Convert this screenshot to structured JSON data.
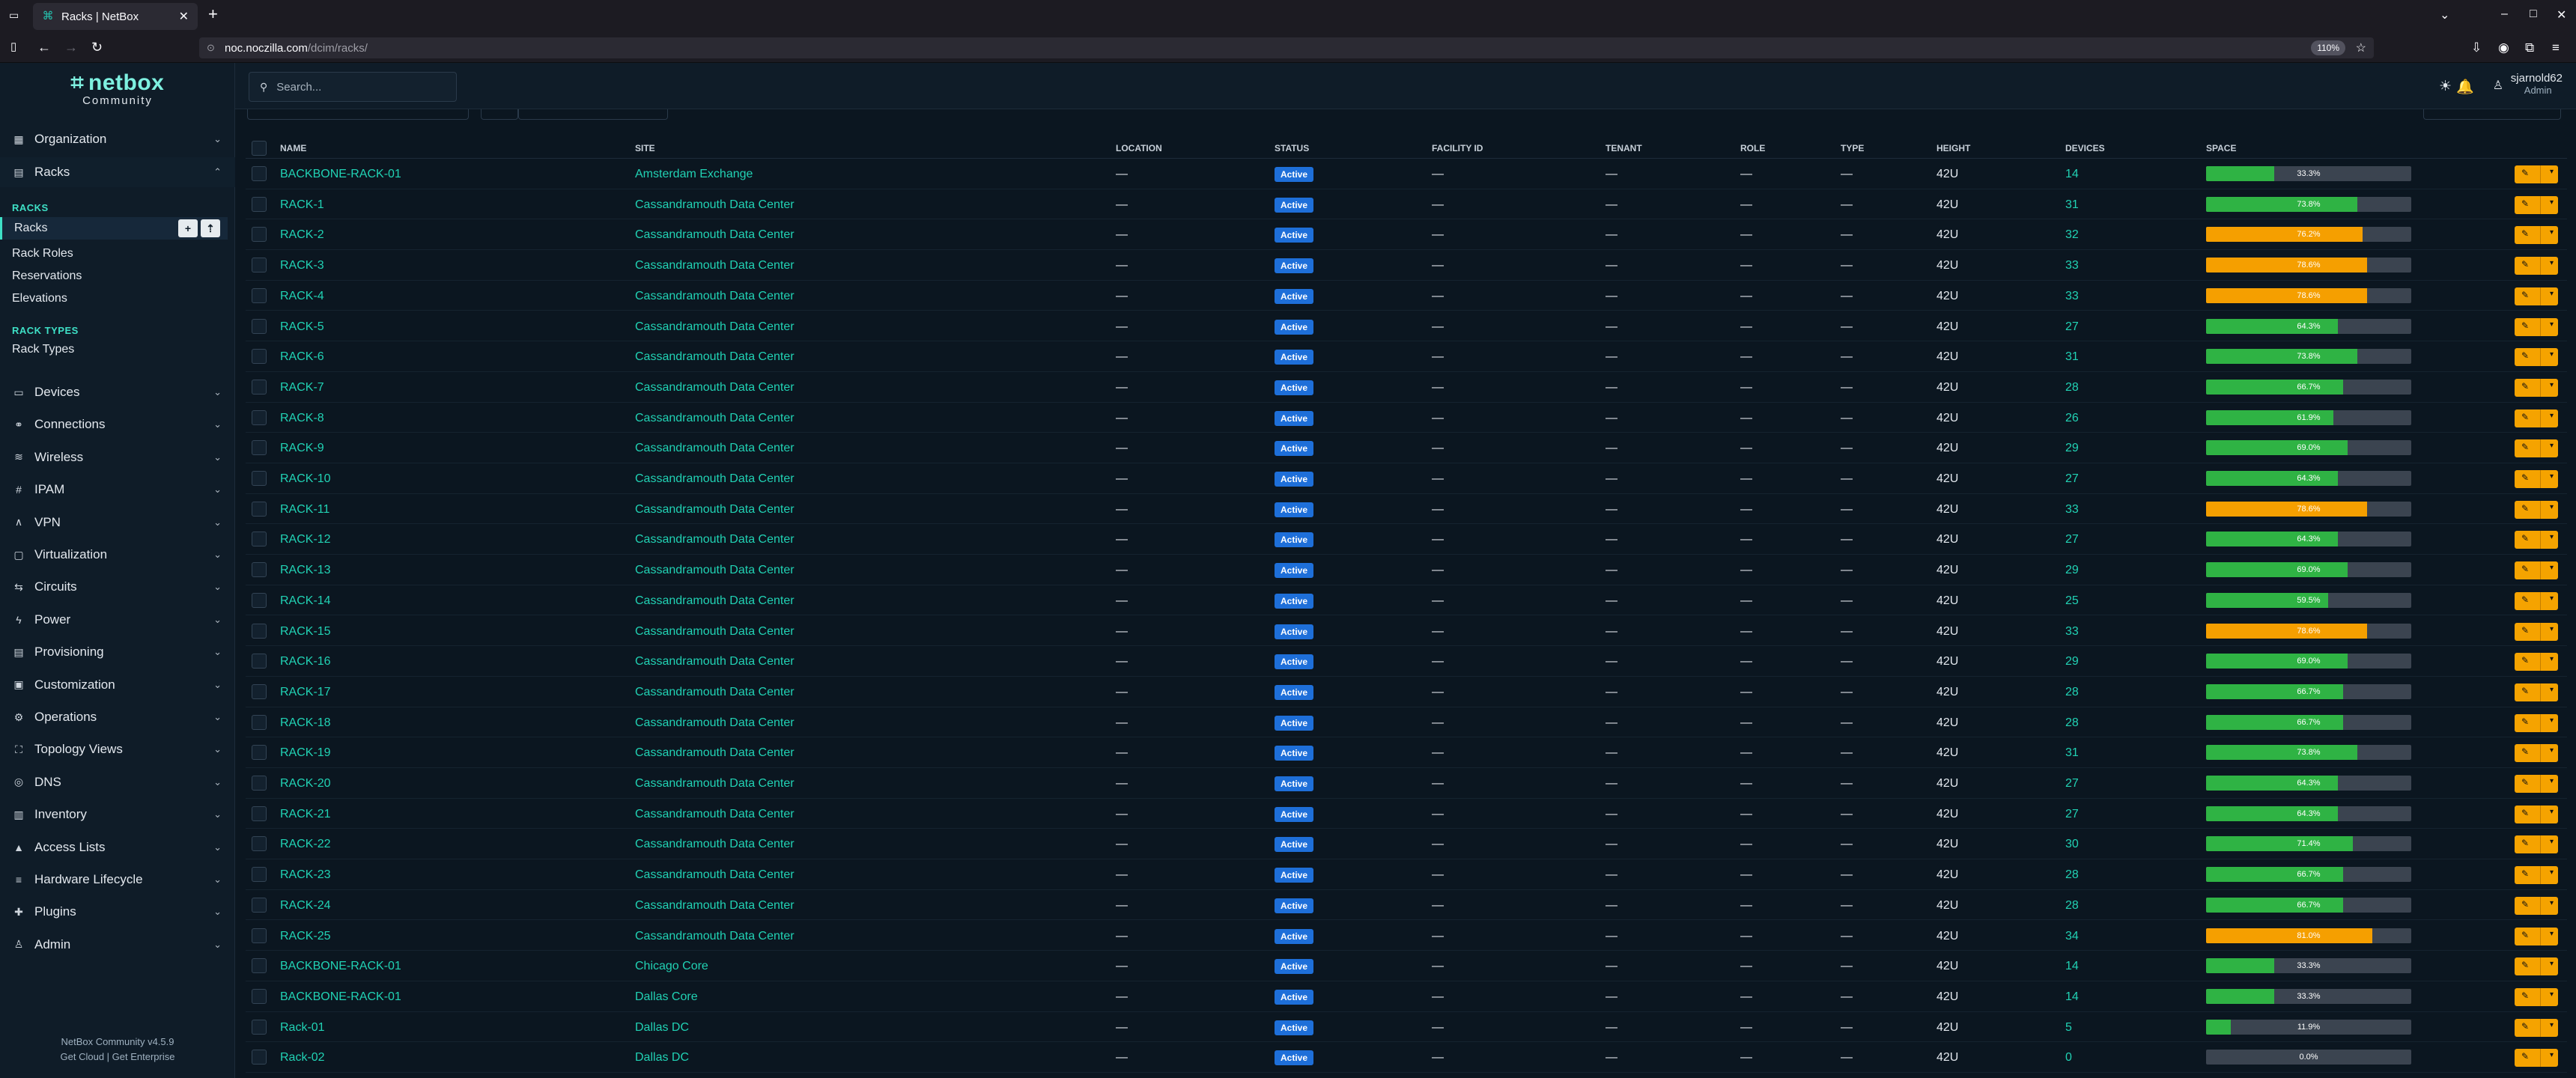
{
  "browser": {
    "tab_title": "Racks | NetBox",
    "url_host": "noc.noczilla.com",
    "url_prefix": "",
    "url_path": "/dcim/racks/",
    "zoom": "110%"
  },
  "app": {
    "brand": "netbox",
    "brand_sub": "Community",
    "search_placeholder": "Search...",
    "user_name": "sjarnold62",
    "user_role": "Admin",
    "footer_version": "NetBox Community v4.5.9",
    "footer_links": "Get Cloud | Get Enterprise"
  },
  "sidebar": {
    "top_sections": [
      {
        "label": "Organization",
        "icon": "building-icon"
      },
      {
        "label": "Racks",
        "icon": "rack-icon"
      }
    ],
    "racks_group_label": "RACKS",
    "racks_items": [
      "Racks",
      "Rack Roles",
      "Reservations",
      "Elevations"
    ],
    "rack_types_group_label": "RACK TYPES",
    "rack_types_items": [
      "Rack Types"
    ],
    "sections": [
      {
        "label": "Devices",
        "icon": "server-icon"
      },
      {
        "label": "Connections",
        "icon": "connection-icon"
      },
      {
        "label": "Wireless",
        "icon": "wifi-icon"
      },
      {
        "label": "IPAM",
        "icon": "counter-icon"
      },
      {
        "label": "VPN",
        "icon": "tunnel-icon"
      },
      {
        "label": "Virtualization",
        "icon": "monitor-icon"
      },
      {
        "label": "Circuits",
        "icon": "transit-icon"
      },
      {
        "label": "Power",
        "icon": "flash-icon"
      },
      {
        "label": "Provisioning",
        "icon": "file-icon"
      },
      {
        "label": "Customization",
        "icon": "toolbox-icon"
      },
      {
        "label": "Operations",
        "icon": "cogs-icon"
      },
      {
        "label": "Topology Views",
        "icon": "graph-icon"
      },
      {
        "label": "DNS",
        "icon": "dns-icon"
      },
      {
        "label": "Inventory",
        "icon": "inventory-icon"
      },
      {
        "label": "Access Lists",
        "icon": "lock-icon"
      },
      {
        "label": "Hardware Lifecycle",
        "icon": "lifecycle-icon"
      },
      {
        "label": "Plugins",
        "icon": "puzzle-icon"
      },
      {
        "label": "Admin",
        "icon": "account-icon"
      }
    ]
  },
  "table": {
    "headers": [
      "NAME",
      "SITE",
      "LOCATION",
      "STATUS",
      "FACILITY ID",
      "TENANT",
      "ROLE",
      "TYPE",
      "HEIGHT",
      "DEVICES",
      "SPACE"
    ],
    "empty": "—",
    "colors": {
      "green": "#2fb344",
      "orange": "#f59f00"
    },
    "rows": [
      {
        "name": "BACKBONE-RACK-01",
        "site": "Amsterdam Exchange",
        "status": "Active",
        "height": "42U",
        "devices": "14",
        "space": 33.3,
        "space_label": "33.3%"
      },
      {
        "name": "RACK-1",
        "site": "Cassandramouth Data Center",
        "status": "Active",
        "height": "42U",
        "devices": "31",
        "space": 73.8,
        "space_label": "73.8%"
      },
      {
        "name": "RACK-2",
        "site": "Cassandramouth Data Center",
        "status": "Active",
        "height": "42U",
        "devices": "32",
        "space": 76.2,
        "space_label": "76.2%"
      },
      {
        "name": "RACK-3",
        "site": "Cassandramouth Data Center",
        "status": "Active",
        "height": "42U",
        "devices": "33",
        "space": 78.6,
        "space_label": "78.6%"
      },
      {
        "name": "RACK-4",
        "site": "Cassandramouth Data Center",
        "status": "Active",
        "height": "42U",
        "devices": "33",
        "space": 78.6,
        "space_label": "78.6%"
      },
      {
        "name": "RACK-5",
        "site": "Cassandramouth Data Center",
        "status": "Active",
        "height": "42U",
        "devices": "27",
        "space": 64.3,
        "space_label": "64.3%"
      },
      {
        "name": "RACK-6",
        "site": "Cassandramouth Data Center",
        "status": "Active",
        "height": "42U",
        "devices": "31",
        "space": 73.8,
        "space_label": "73.8%"
      },
      {
        "name": "RACK-7",
        "site": "Cassandramouth Data Center",
        "status": "Active",
        "height": "42U",
        "devices": "28",
        "space": 66.7,
        "space_label": "66.7%"
      },
      {
        "name": "RACK-8",
        "site": "Cassandramouth Data Center",
        "status": "Active",
        "height": "42U",
        "devices": "26",
        "space": 61.9,
        "space_label": "61.9%"
      },
      {
        "name": "RACK-9",
        "site": "Cassandramouth Data Center",
        "status": "Active",
        "height": "42U",
        "devices": "29",
        "space": 69.0,
        "space_label": "69.0%"
      },
      {
        "name": "RACK-10",
        "site": "Cassandramouth Data Center",
        "status": "Active",
        "height": "42U",
        "devices": "27",
        "space": 64.3,
        "space_label": "64.3%"
      },
      {
        "name": "RACK-11",
        "site": "Cassandramouth Data Center",
        "status": "Active",
        "height": "42U",
        "devices": "33",
        "space": 78.6,
        "space_label": "78.6%"
      },
      {
        "name": "RACK-12",
        "site": "Cassandramouth Data Center",
        "status": "Active",
        "height": "42U",
        "devices": "27",
        "space": 64.3,
        "space_label": "64.3%"
      },
      {
        "name": "RACK-13",
        "site": "Cassandramouth Data Center",
        "status": "Active",
        "height": "42U",
        "devices": "29",
        "space": 69.0,
        "space_label": "69.0%"
      },
      {
        "name": "RACK-14",
        "site": "Cassandramouth Data Center",
        "status": "Active",
        "height": "42U",
        "devices": "25",
        "space": 59.5,
        "space_label": "59.5%"
      },
      {
        "name": "RACK-15",
        "site": "Cassandramouth Data Center",
        "status": "Active",
        "height": "42U",
        "devices": "33",
        "space": 78.6,
        "space_label": "78.6%"
      },
      {
        "name": "RACK-16",
        "site": "Cassandramouth Data Center",
        "status": "Active",
        "height": "42U",
        "devices": "29",
        "space": 69.0,
        "space_label": "69.0%"
      },
      {
        "name": "RACK-17",
        "site": "Cassandramouth Data Center",
        "status": "Active",
        "height": "42U",
        "devices": "28",
        "space": 66.7,
        "space_label": "66.7%"
      },
      {
        "name": "RACK-18",
        "site": "Cassandramouth Data Center",
        "status": "Active",
        "height": "42U",
        "devices": "28",
        "space": 66.7,
        "space_label": "66.7%"
      },
      {
        "name": "RACK-19",
        "site": "Cassandramouth Data Center",
        "status": "Active",
        "height": "42U",
        "devices": "31",
        "space": 73.8,
        "space_label": "73.8%"
      },
      {
        "name": "RACK-20",
        "site": "Cassandramouth Data Center",
        "status": "Active",
        "height": "42U",
        "devices": "27",
        "space": 64.3,
        "space_label": "64.3%"
      },
      {
        "name": "RACK-21",
        "site": "Cassandramouth Data Center",
        "status": "Active",
        "height": "42U",
        "devices": "27",
        "space": 64.3,
        "space_label": "64.3%"
      },
      {
        "name": "RACK-22",
        "site": "Cassandramouth Data Center",
        "status": "Active",
        "height": "42U",
        "devices": "30",
        "space": 71.4,
        "space_label": "71.4%"
      },
      {
        "name": "RACK-23",
        "site": "Cassandramouth Data Center",
        "status": "Active",
        "height": "42U",
        "devices": "28",
        "space": 66.7,
        "space_label": "66.7%"
      },
      {
        "name": "RACK-24",
        "site": "Cassandramouth Data Center",
        "status": "Active",
        "height": "42U",
        "devices": "28",
        "space": 66.7,
        "space_label": "66.7%"
      },
      {
        "name": "RACK-25",
        "site": "Cassandramouth Data Center",
        "status": "Active",
        "height": "42U",
        "devices": "34",
        "space": 81.0,
        "space_label": "81.0%"
      },
      {
        "name": "BACKBONE-RACK-01",
        "site": "Chicago Core",
        "status": "Active",
        "height": "42U",
        "devices": "14",
        "space": 33.3,
        "space_label": "33.3%"
      },
      {
        "name": "BACKBONE-RACK-01",
        "site": "Dallas Core",
        "status": "Active",
        "height": "42U",
        "devices": "14",
        "space": 33.3,
        "space_label": "33.3%"
      },
      {
        "name": "Rack-01",
        "site": "Dallas DC",
        "status": "Active",
        "height": "42U",
        "devices": "5",
        "space": 11.9,
        "space_label": "11.9%"
      },
      {
        "name": "Rack-02",
        "site": "Dallas DC",
        "status": "Active",
        "height": "42U",
        "devices": "0",
        "space": 0.0,
        "space_label": "0.0%"
      }
    ]
  }
}
